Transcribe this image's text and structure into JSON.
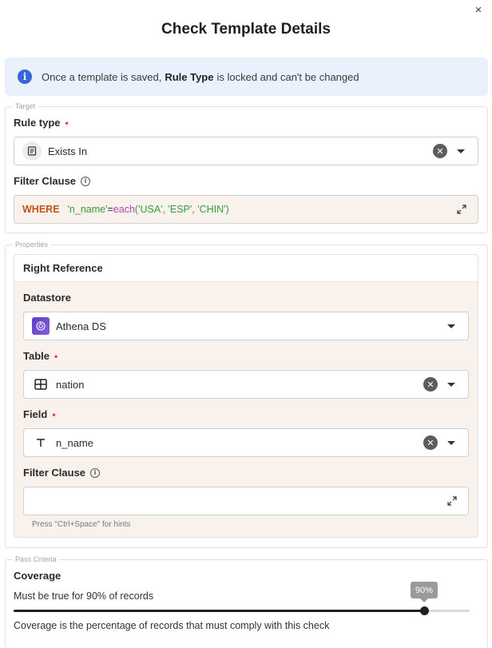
{
  "dialog": {
    "title": "Check Template Details",
    "close_label": "×"
  },
  "banner": {
    "text_before": "Once a template is saved,",
    "text_bold": "Rule Type",
    "text_after": "is locked and can't be changed",
    "icon": "info-icon"
  },
  "target": {
    "legend": "Target",
    "rule_type_label": "Rule type",
    "rule_type_value": "Exists In",
    "filter_label": "Filter Clause",
    "filter": {
      "keyword": "WHERE",
      "field": "'n_name'",
      "op": "=",
      "fn": "each",
      "args": "('USA', 'ESP', 'CHIN')"
    }
  },
  "properties": {
    "legend": "Properties",
    "card_title": "Right Reference",
    "datastore_label": "Datastore",
    "datastore_value": "Athena DS",
    "table_label": "Table",
    "table_value": "nation",
    "field_label": "Field",
    "field_value": "n_name",
    "filter_label": "Filter Clause",
    "filter_value": "",
    "filter_hint": "Press \"Ctrl+Space\" for hints"
  },
  "pass_criteria": {
    "legend": "Pass Criteria",
    "coverage_label": "Coverage",
    "coverage_text": "Must be true for 90% of records",
    "coverage_value_label": "90%",
    "coverage_fraction": 0.9,
    "coverage_help": "Coverage is the percentage of records that must comply with this check"
  },
  "colors": {
    "accent": "#3566d6",
    "required": "#e53950",
    "code_bg": "#f8f1ec"
  }
}
